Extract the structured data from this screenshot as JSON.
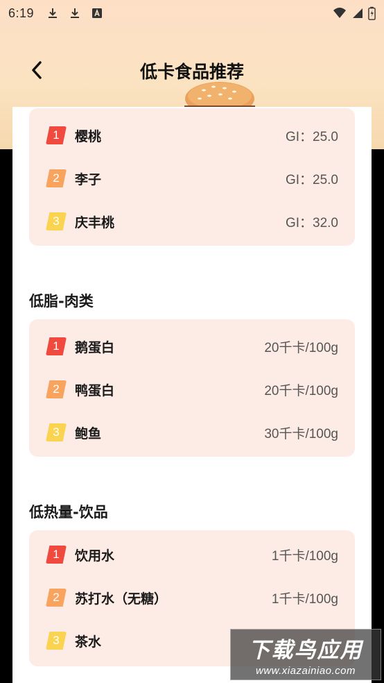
{
  "status_bar": {
    "time": "6:19",
    "left_icons": [
      "download-icon",
      "download-icon",
      "text-icon"
    ],
    "right_icons": [
      "wifi-icon",
      "signal-icon",
      "battery-icon"
    ]
  },
  "header": {
    "title": "低卡食品推荐",
    "back_icon": "chevron-left-icon"
  },
  "sections": [
    {
      "title": "",
      "items": [
        {
          "rank": "1",
          "name": "樱桃",
          "value": "GI：25.0"
        },
        {
          "rank": "2",
          "name": "李子",
          "value": "GI：25.0"
        },
        {
          "rank": "3",
          "name": "庆丰桃",
          "value": "GI：32.0"
        }
      ]
    },
    {
      "title": "低脂-肉类",
      "items": [
        {
          "rank": "1",
          "name": "鹅蛋白",
          "value": "20千卡/100g"
        },
        {
          "rank": "2",
          "name": "鸭蛋白",
          "value": "20千卡/100g"
        },
        {
          "rank": "3",
          "name": "鲍鱼",
          "value": "30千卡/100g"
        }
      ]
    },
    {
      "title": "低热量-饮品",
      "items": [
        {
          "rank": "1",
          "name": "饮用水",
          "value": "1千卡/100g"
        },
        {
          "rank": "2",
          "name": "苏打水（无糖）",
          "value": "1千卡/100g"
        },
        {
          "rank": "3",
          "name": "茶水",
          "value": ""
        }
      ]
    }
  ],
  "watermark": {
    "main": "下载鸟应用",
    "sub": "www.xiazainiao.com"
  },
  "colors": {
    "rank_1": "#ef4a3d",
    "rank_2": "#f9a45e",
    "rank_3": "#fad350",
    "group_bg": "#fdece6"
  }
}
